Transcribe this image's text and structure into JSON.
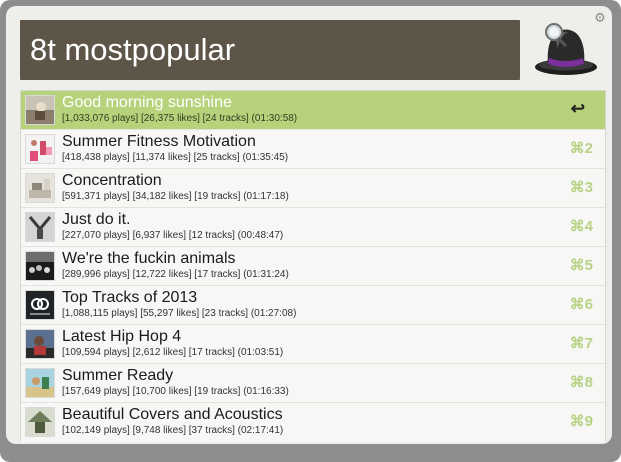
{
  "query": "8t mostpopular",
  "colors": {
    "selected_row": "#b6d37c",
    "shortcut": "#b8d386",
    "query_bg": "#5d5547"
  },
  "icons": {
    "settings": "gear-icon",
    "app": "alfred-hat-icon",
    "action": "return-icon"
  },
  "results": [
    {
      "title": "Good morning sunshine",
      "subtitle": "[1,033,076 plays] [26,375 likes] [24 tracks] (01:30:58)",
      "shortcut": "↩"
    },
    {
      "title": "Summer Fitness Motivation",
      "subtitle": "[418,438 plays] [11,374 likes] [25 tracks] (01:35:45)",
      "shortcut": "⌘2"
    },
    {
      "title": "Concentration",
      "subtitle": "[591,371 plays] [34,182 likes] [19 tracks] (01:17:18)",
      "shortcut": "⌘3"
    },
    {
      "title": "Just do it.",
      "subtitle": "[227,070 plays] [6,937 likes] [12 tracks] (00:48:47)",
      "shortcut": "⌘4"
    },
    {
      "title": "We're the fuckin animals",
      "subtitle": "[289,996 plays] [12,722 likes] [17 tracks] (01:31:24)",
      "shortcut": "⌘5"
    },
    {
      "title": "Top Tracks of 2013",
      "subtitle": "[1,088,115 plays] [55,297 likes] [23 tracks] (01:27:08)",
      "shortcut": "⌘6"
    },
    {
      "title": "Latest Hip Hop 4",
      "subtitle": "[109,594 plays] [2,612 likes] [17 tracks] (01:03:51)",
      "shortcut": "⌘7"
    },
    {
      "title": "Summer Ready",
      "subtitle": "[157,649 plays] [10,700 likes] [19 tracks] (01:16:33)",
      "shortcut": "⌘8"
    },
    {
      "title": "Beautiful Covers and Acoustics",
      "subtitle": "[102,149 plays] [9,748 likes] [37 tracks] (02:17:41)",
      "shortcut": "⌘9"
    }
  ]
}
